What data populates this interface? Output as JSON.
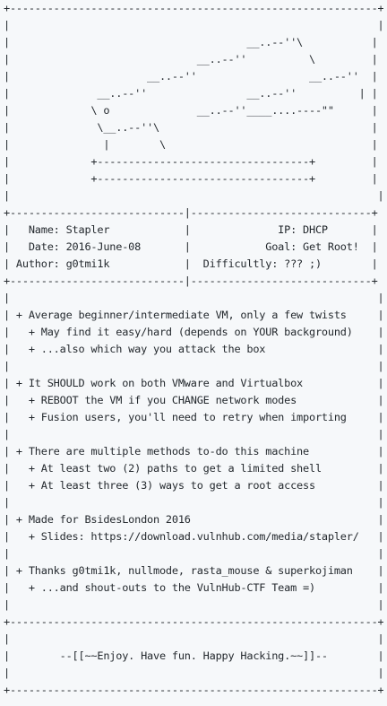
{
  "readme": {
    "text": "+-----------------------------------------------------------+\n|                                                           |\n|                                      __..--''\\           |\n|                              __..--''          \\         |\n|                      __..--''                  __..--''  |\n|              __..--''                __..--''          | |\n|             \\ o              __..--''____....----\"\"      |\n|              \\__..--''\\                                  |\n|               |        \\                                 |\n|             +----------------------------------+         |\n|             +----------------------------------+         |\n|                                                           |\n+----------------------------|-----------------------------+\n|   Name: Stapler            |              IP: DHCP       |\n|   Date: 2016-June-08       |            Goal: Get Root!  |\n| Author: g0tmi1k            |  Difficultly: ??? ;)        |\n+----------------------------|-----------------------------+\n|                                                           |\n| + Average beginner/intermediate VM, only a few twists     |\n|   + May find it easy/hard (depends on YOUR background)    |\n|   + ...also which way you attack the box                  |\n|                                                           |\n| + It SHOULD work on both VMware and Virtualbox            |\n|   + REBOOT the VM if you CHANGE network modes             |\n|   + Fusion users, you'll need to retry when importing     |\n|                                                           |\n| + There are multiple methods to-do this machine           |\n|   + At least two (2) paths to get a limited shell         |\n|   + At least three (3) ways to get a root access          |\n|                                                           |\n| + Made for BsidesLondon 2016                              |\n|   + Slides: https://download.vulnhub.com/media/stapler/   |\n|                                                           |\n| + Thanks g0tmi1k, nullmode, rasta_mouse & superkojiman    |\n|   + ...and shout-outs to the VulnHub-CTF Team =)          |\n|                                                           |\n+-----------------------------------------------------------+\n|                                                           |\n|        --[[~~Enjoy. Have fun. Happy Hacking.~~]]--        |\n|                                                           |\n+-----------------------------------------------------------+"
  }
}
